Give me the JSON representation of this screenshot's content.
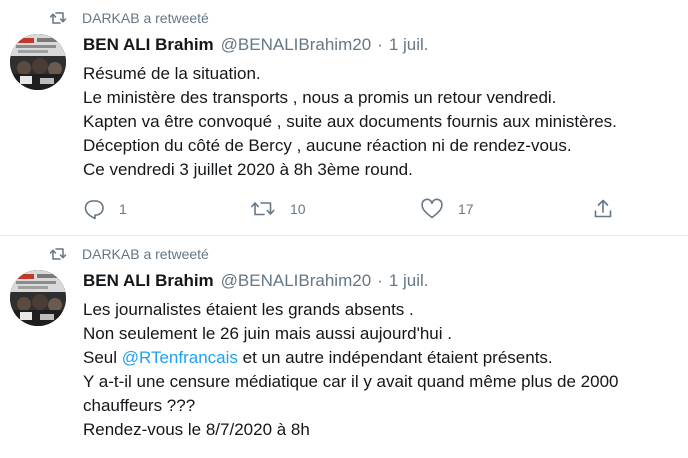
{
  "tweets": [
    {
      "retweeted_by": "DARKAB a retweeté",
      "author_name": "BEN ALI Brahim",
      "author_handle": "@BENALIBrahim20",
      "separator": "·",
      "date": "1 juil.",
      "lines": [
        "Résumé de la situation.",
        "Le ministère des transports , nous a promis un retour vendredi.",
        "Kapten va être convoqué , suite aux documents fournis aux ministères.",
        "Déception du côté de Bercy , aucune réaction ni de rendez-vous.",
        "Ce vendredi 3 juillet 2020 à 8h 3ème round."
      ],
      "reply_count": "1",
      "retweet_count": "10",
      "like_count": "17"
    },
    {
      "retweeted_by": "DARKAB a retweeté",
      "author_name": "BEN ALI Brahim",
      "author_handle": "@BENALIBrahim20",
      "separator": "·",
      "date": "1 juil.",
      "lines": [
        "Les journalistes étaient les grands absents .",
        "Non seulement le 26 juin mais aussi aujourd'hui .",
        "",
        "Y a-t-il une censure médiatique car il y avait quand même plus de 2000",
        "chauffeurs ???",
        "Rendez-vous le 8/7/2020 à 8h"
      ],
      "line3_prefix": "Seul ",
      "line3_mention": "@RTenfrancais",
      "line3_suffix": " et un autre indépendant étaient présents."
    }
  ],
  "icons": {
    "retweet_indicator": "retweet-icon",
    "reply": "reply-icon",
    "retweet": "retweet-icon",
    "like": "heart-icon",
    "share": "share-icon"
  },
  "colors": {
    "text": "#14171a",
    "secondary": "#657786",
    "link": "#1da1f2",
    "divider": "#e6ecf0"
  }
}
